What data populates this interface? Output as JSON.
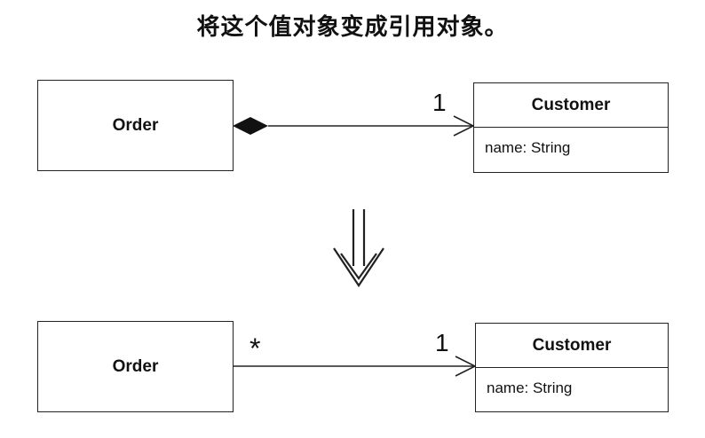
{
  "caption": "将这个值对象变成引用对象。",
  "before": {
    "order_label": "Order",
    "customer_label": "Customer",
    "customer_attribute": "name: String",
    "multiplicity_customer": "1"
  },
  "after": {
    "order_label": "Order",
    "customer_label": "Customer",
    "customer_attribute": "name: String",
    "multiplicity_order": "*",
    "multiplicity_customer": "1"
  }
}
